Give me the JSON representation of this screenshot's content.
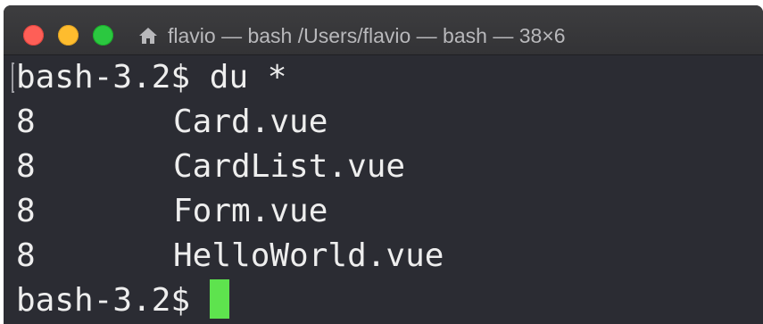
{
  "window": {
    "title": "flavio — bash /Users/flavio — bash — 38×6",
    "title_icon": "home-icon",
    "controls": [
      "close",
      "minimize",
      "zoom"
    ],
    "colors": {
      "close": "#fe5f57",
      "minimize": "#febc2e",
      "zoom": "#2bc840",
      "terminal_bg": "#2b2c33",
      "cursor": "#5ee34e"
    }
  },
  "terminal": {
    "prompt": "bash-3.2$",
    "command": "du *",
    "output": [
      {
        "size": "8",
        "name": "Card.vue"
      },
      {
        "size": "8",
        "name": "CardList.vue"
      },
      {
        "size": "8",
        "name": "Form.vue"
      },
      {
        "size": "8",
        "name": "HelloWorld.vue"
      }
    ],
    "final_prompt": "bash-3.2$"
  }
}
